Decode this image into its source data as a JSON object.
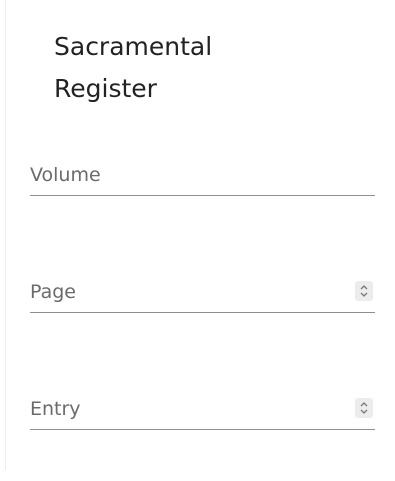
{
  "register": {
    "title_line1": "Sacramental",
    "title_line2": "Register"
  },
  "fields": {
    "volume": {
      "placeholder": "Volume",
      "value": ""
    },
    "page": {
      "placeholder": "Page",
      "value": ""
    },
    "entry": {
      "placeholder": "Entry",
      "value": ""
    }
  },
  "icons": {
    "spinner": "up-down-chevron-icon"
  }
}
